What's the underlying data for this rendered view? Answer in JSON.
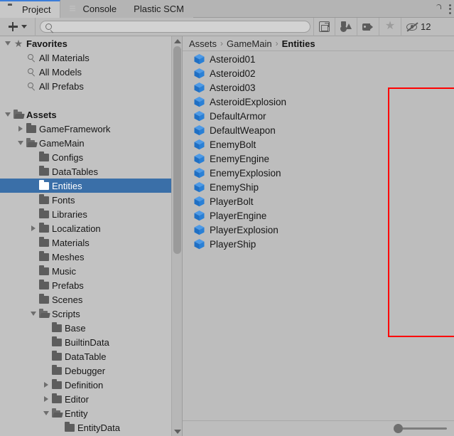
{
  "window": {
    "tabs": [
      {
        "label": "Project",
        "icon": "folder-icon",
        "active": true
      },
      {
        "label": "Console",
        "icon": "console-list-icon",
        "active": false
      },
      {
        "label": "Plastic SCM",
        "icon": "none",
        "active": false
      }
    ],
    "controls": [
      {
        "name": "lock-icon",
        "label": ""
      },
      {
        "name": "kebab-menu-icon",
        "label": ""
      }
    ]
  },
  "toolbar": {
    "create_label": "+",
    "create_dropdown": "▾",
    "search": {
      "value": "",
      "placeholder": ""
    },
    "buttons": [
      {
        "name": "search-in-packages-toggle",
        "icon": "packages-icon"
      },
      {
        "name": "filter-by-type-button",
        "icon": "shapes-icon"
      },
      {
        "name": "filter-by-label-button",
        "icon": "tag-icon"
      },
      {
        "name": "filter-favorites-button",
        "icon": "star-icon"
      }
    ],
    "hidden_count_icon": "eye-slash-icon",
    "hidden_count": "12"
  },
  "sidebar": {
    "items": [
      {
        "label": "Favorites",
        "depth": 0,
        "arrow": "down",
        "icon": "star",
        "bold": true
      },
      {
        "label": "All Materials",
        "depth": 1,
        "arrow": "none",
        "icon": "search",
        "bold": false
      },
      {
        "label": "All Models",
        "depth": 1,
        "arrow": "none",
        "icon": "search",
        "bold": false
      },
      {
        "label": "All Prefabs",
        "depth": 1,
        "arrow": "none",
        "icon": "search",
        "bold": false
      },
      {
        "label": "",
        "depth": 0,
        "arrow": "none",
        "icon": "none",
        "bold": false
      },
      {
        "label": "Assets",
        "depth": 0,
        "arrow": "down",
        "icon": "folder-open",
        "bold": true
      },
      {
        "label": "GameFramework",
        "depth": 1,
        "arrow": "right",
        "icon": "folder",
        "bold": false
      },
      {
        "label": "GameMain",
        "depth": 1,
        "arrow": "down",
        "icon": "folder-open",
        "bold": false
      },
      {
        "label": "Configs",
        "depth": 2,
        "arrow": "none",
        "icon": "folder",
        "bold": false
      },
      {
        "label": "DataTables",
        "depth": 2,
        "arrow": "none",
        "icon": "folder",
        "bold": false
      },
      {
        "label": "Entities",
        "depth": 2,
        "arrow": "none",
        "icon": "folder",
        "bold": false,
        "selected": true
      },
      {
        "label": "Fonts",
        "depth": 2,
        "arrow": "none",
        "icon": "folder",
        "bold": false
      },
      {
        "label": "Libraries",
        "depth": 2,
        "arrow": "none",
        "icon": "folder",
        "bold": false
      },
      {
        "label": "Localization",
        "depth": 2,
        "arrow": "right",
        "icon": "folder",
        "bold": false
      },
      {
        "label": "Materials",
        "depth": 2,
        "arrow": "none",
        "icon": "folder",
        "bold": false
      },
      {
        "label": "Meshes",
        "depth": 2,
        "arrow": "none",
        "icon": "folder",
        "bold": false
      },
      {
        "label": "Music",
        "depth": 2,
        "arrow": "none",
        "icon": "folder",
        "bold": false
      },
      {
        "label": "Prefabs",
        "depth": 2,
        "arrow": "none",
        "icon": "folder",
        "bold": false
      },
      {
        "label": "Scenes",
        "depth": 2,
        "arrow": "none",
        "icon": "folder",
        "bold": false
      },
      {
        "label": "Scripts",
        "depth": 2,
        "arrow": "down",
        "icon": "folder-open",
        "bold": false
      },
      {
        "label": "Base",
        "depth": 3,
        "arrow": "none",
        "icon": "folder",
        "bold": false
      },
      {
        "label": "BuiltinData",
        "depth": 3,
        "arrow": "none",
        "icon": "folder",
        "bold": false
      },
      {
        "label": "DataTable",
        "depth": 3,
        "arrow": "none",
        "icon": "folder",
        "bold": false
      },
      {
        "label": "Debugger",
        "depth": 3,
        "arrow": "none",
        "icon": "folder",
        "bold": false
      },
      {
        "label": "Definition",
        "depth": 3,
        "arrow": "right",
        "icon": "folder",
        "bold": false
      },
      {
        "label": "Editor",
        "depth": 3,
        "arrow": "right",
        "icon": "folder",
        "bold": false
      },
      {
        "label": "Entity",
        "depth": 3,
        "arrow": "down",
        "icon": "folder-open",
        "bold": false
      },
      {
        "label": "EntityData",
        "depth": 4,
        "arrow": "none",
        "icon": "folder",
        "bold": false
      }
    ]
  },
  "breadcrumb": {
    "separator": "›",
    "crumbs": [
      {
        "label": "Assets",
        "current": false
      },
      {
        "label": "GameMain",
        "current": false
      },
      {
        "label": "Entities",
        "current": true
      }
    ]
  },
  "assets": {
    "items": [
      {
        "label": "Asteroid01",
        "icon": "prefab-cube-icon"
      },
      {
        "label": "Asteroid02",
        "icon": "prefab-cube-icon"
      },
      {
        "label": "Asteroid03",
        "icon": "prefab-cube-icon"
      },
      {
        "label": "AsteroidExplosion",
        "icon": "prefab-cube-icon"
      },
      {
        "label": "DefaultArmor",
        "icon": "prefab-cube-icon"
      },
      {
        "label": "DefaultWeapon",
        "icon": "prefab-cube-icon"
      },
      {
        "label": "EnemyBolt",
        "icon": "prefab-cube-icon"
      },
      {
        "label": "EnemyEngine",
        "icon": "prefab-cube-icon"
      },
      {
        "label": "EnemyExplosion",
        "icon": "prefab-cube-icon"
      },
      {
        "label": "EnemyShip",
        "icon": "prefab-cube-icon"
      },
      {
        "label": "PlayerBolt",
        "icon": "prefab-cube-icon"
      },
      {
        "label": "PlayerEngine",
        "icon": "prefab-cube-icon"
      },
      {
        "label": "PlayerExplosion",
        "icon": "prefab-cube-icon"
      },
      {
        "label": "PlayerShip",
        "icon": "prefab-cube-icon"
      }
    ]
  },
  "annotation": {
    "type": "red-rectangle-highlight",
    "color": "#fe0000"
  },
  "colors": {
    "selection_blue": "#3a6fa8",
    "tab_accent": "#3c7dd9",
    "prefab_icon": "#2e7fd4",
    "panel_bg": "#bdbdbd",
    "sidebar_bg": "#c2c2c2",
    "annotation_red": "#fe0000"
  }
}
